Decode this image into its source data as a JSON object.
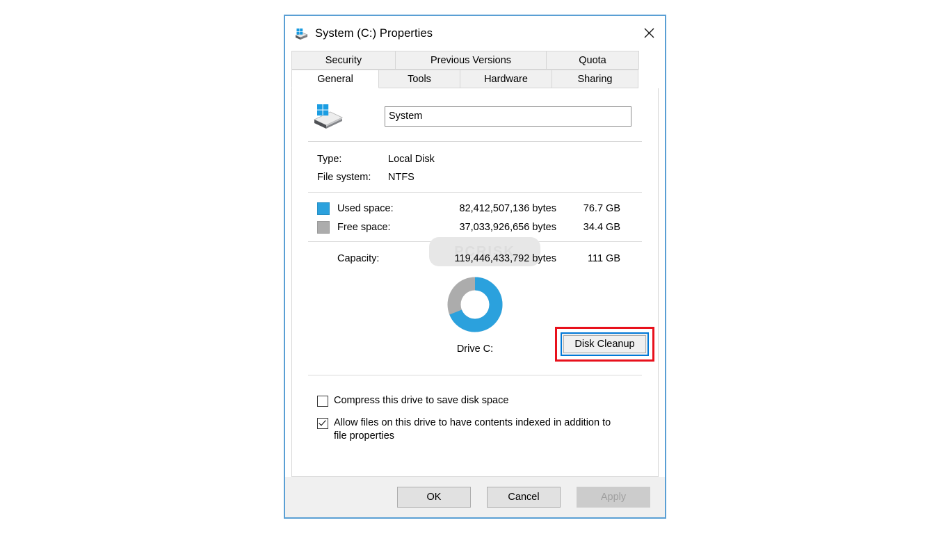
{
  "window": {
    "title": "System (C:) Properties",
    "icon": "drive-icon",
    "close_label": "✕"
  },
  "tabs": {
    "row1": [
      {
        "label": "Security",
        "active": false
      },
      {
        "label": "Previous Versions",
        "active": false
      },
      {
        "label": "Quota",
        "active": false
      }
    ],
    "row2": [
      {
        "label": "General",
        "active": true
      },
      {
        "label": "Tools",
        "active": false
      },
      {
        "label": "Hardware",
        "active": false
      },
      {
        "label": "Sharing",
        "active": false
      }
    ]
  },
  "general": {
    "volume_name": "System",
    "volume_name_placeholder": "",
    "type_label": "Type:",
    "type_value": "Local Disk",
    "filesystem_label": "File system:",
    "filesystem_value": "NTFS",
    "used": {
      "label": "Used space:",
      "bytes": "82,412,507,136 bytes",
      "size": "76.7 GB",
      "color": "#2ba1dd"
    },
    "free": {
      "label": "Free space:",
      "bytes": "37,033,926,656 bytes",
      "size": "34.4 GB",
      "color": "#acacac"
    },
    "capacity": {
      "label": "Capacity:",
      "bytes": "119,446,433,792 bytes",
      "size": "111 GB"
    },
    "watermark_text": "PCRISK",
    "drive_label": "Drive C:",
    "disk_cleanup_label": "Disk Cleanup",
    "highlight_color": "#e8111c",
    "focus_color": "#0078d7",
    "compress_checkbox": {
      "label": "Compress this drive to save disk space",
      "checked": false
    },
    "index_checkbox": {
      "label": "Allow files on this drive to have contents indexed in addition to file properties",
      "checked": true
    }
  },
  "chart_data": {
    "type": "pie",
    "title": "Drive C:",
    "categories": [
      "Used space",
      "Free space"
    ],
    "values": [
      82412507136,
      37033926656
    ],
    "percentages": [
      69.0,
      31.0
    ],
    "labels": [
      "76.7 GB",
      "34.4 GB"
    ],
    "colors": [
      "#2ba1dd",
      "#acacac"
    ],
    "total": 119446433792,
    "total_label": "111 GB",
    "donut": true,
    "start_angle_deg": 0,
    "legend": "left"
  },
  "footer": {
    "ok_label": "OK",
    "cancel_label": "Cancel",
    "apply_label": "Apply",
    "apply_disabled": true
  }
}
